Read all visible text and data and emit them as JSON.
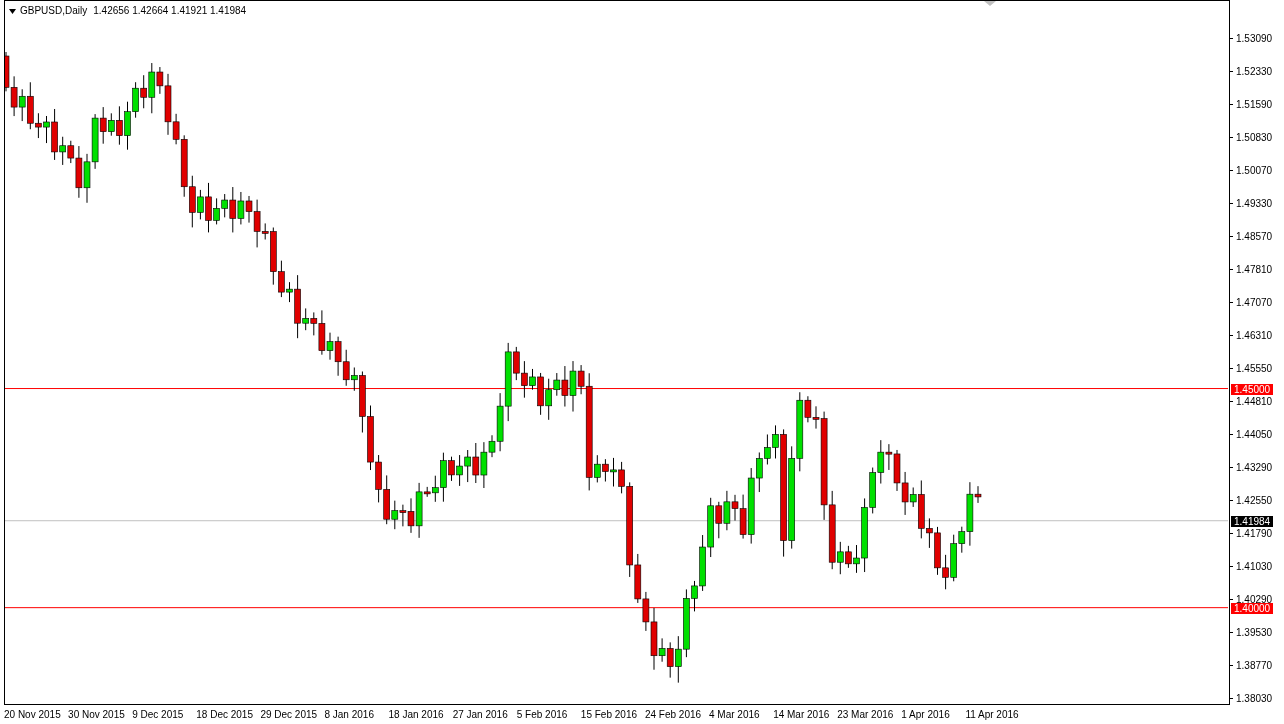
{
  "chart": {
    "symbol": "GBPUSD,Daily",
    "ohlc": "1.42656 1.42664 1.41921 1.41984"
  },
  "price_axis": {
    "ticks": [
      "1.53090",
      "1.52330",
      "1.51590",
      "1.50830",
      "1.50070",
      "1.49330",
      "1.48570",
      "1.47810",
      "1.47070",
      "1.46310",
      "1.45550",
      "1.44810",
      "1.44050",
      "1.43290",
      "1.42550",
      "1.41790",
      "1.41030",
      "1.40290",
      "1.39530",
      "1.38770",
      "1.38030"
    ],
    "markers": [
      {
        "label": "1.45000",
        "kind": "level_line",
        "color": "#ff0000"
      },
      {
        "label": "1.41984",
        "kind": "bid_line",
        "color": "#000000"
      },
      {
        "label": "1.40000",
        "kind": "level_line",
        "color": "#ff0000"
      }
    ]
  },
  "time_axis": [
    "20 Nov 2015",
    "30 Nov 2015",
    "9 Dec 2015",
    "18 Dec 2015",
    "29 Dec 2015",
    "8 Jan 2016",
    "18 Jan 2016",
    "27 Jan 2016",
    "5 Feb 2016",
    "15 Feb 2016",
    "24 Feb 2016",
    "4 Mar 2016",
    "14 Mar 2016",
    "23 Mar 2016",
    "1 Apr 2016",
    "11 Apr 2016"
  ]
}
